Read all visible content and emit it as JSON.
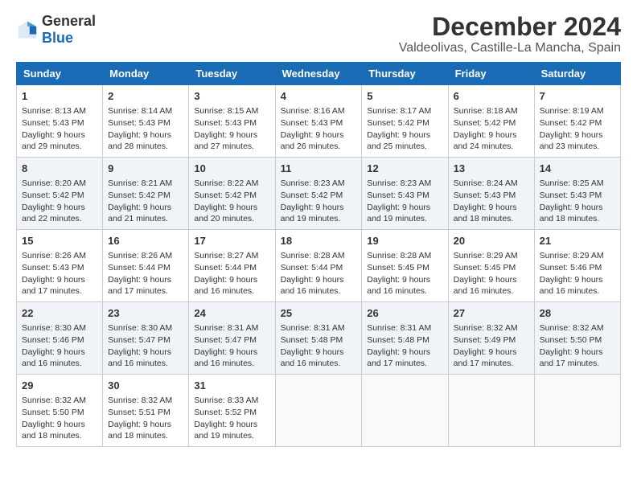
{
  "header": {
    "logo_general": "General",
    "logo_blue": "Blue",
    "title": "December 2024",
    "subtitle": "Valdeolivas, Castille-La Mancha, Spain"
  },
  "calendar": {
    "columns": [
      "Sunday",
      "Monday",
      "Tuesday",
      "Wednesday",
      "Thursday",
      "Friday",
      "Saturday"
    ],
    "weeks": [
      [
        {
          "day": "1",
          "sunrise": "Sunrise: 8:13 AM",
          "sunset": "Sunset: 5:43 PM",
          "daylight": "Daylight: 9 hours and 29 minutes."
        },
        {
          "day": "2",
          "sunrise": "Sunrise: 8:14 AM",
          "sunset": "Sunset: 5:43 PM",
          "daylight": "Daylight: 9 hours and 28 minutes."
        },
        {
          "day": "3",
          "sunrise": "Sunrise: 8:15 AM",
          "sunset": "Sunset: 5:43 PM",
          "daylight": "Daylight: 9 hours and 27 minutes."
        },
        {
          "day": "4",
          "sunrise": "Sunrise: 8:16 AM",
          "sunset": "Sunset: 5:43 PM",
          "daylight": "Daylight: 9 hours and 26 minutes."
        },
        {
          "day": "5",
          "sunrise": "Sunrise: 8:17 AM",
          "sunset": "Sunset: 5:42 PM",
          "daylight": "Daylight: 9 hours and 25 minutes."
        },
        {
          "day": "6",
          "sunrise": "Sunrise: 8:18 AM",
          "sunset": "Sunset: 5:42 PM",
          "daylight": "Daylight: 9 hours and 24 minutes."
        },
        {
          "day": "7",
          "sunrise": "Sunrise: 8:19 AM",
          "sunset": "Sunset: 5:42 PM",
          "daylight": "Daylight: 9 hours and 23 minutes."
        }
      ],
      [
        {
          "day": "8",
          "sunrise": "Sunrise: 8:20 AM",
          "sunset": "Sunset: 5:42 PM",
          "daylight": "Daylight: 9 hours and 22 minutes."
        },
        {
          "day": "9",
          "sunrise": "Sunrise: 8:21 AM",
          "sunset": "Sunset: 5:42 PM",
          "daylight": "Daylight: 9 hours and 21 minutes."
        },
        {
          "day": "10",
          "sunrise": "Sunrise: 8:22 AM",
          "sunset": "Sunset: 5:42 PM",
          "daylight": "Daylight: 9 hours and 20 minutes."
        },
        {
          "day": "11",
          "sunrise": "Sunrise: 8:23 AM",
          "sunset": "Sunset: 5:42 PM",
          "daylight": "Daylight: 9 hours and 19 minutes."
        },
        {
          "day": "12",
          "sunrise": "Sunrise: 8:23 AM",
          "sunset": "Sunset: 5:43 PM",
          "daylight": "Daylight: 9 hours and 19 minutes."
        },
        {
          "day": "13",
          "sunrise": "Sunrise: 8:24 AM",
          "sunset": "Sunset: 5:43 PM",
          "daylight": "Daylight: 9 hours and 18 minutes."
        },
        {
          "day": "14",
          "sunrise": "Sunrise: 8:25 AM",
          "sunset": "Sunset: 5:43 PM",
          "daylight": "Daylight: 9 hours and 18 minutes."
        }
      ],
      [
        {
          "day": "15",
          "sunrise": "Sunrise: 8:26 AM",
          "sunset": "Sunset: 5:43 PM",
          "daylight": "Daylight: 9 hours and 17 minutes."
        },
        {
          "day": "16",
          "sunrise": "Sunrise: 8:26 AM",
          "sunset": "Sunset: 5:44 PM",
          "daylight": "Daylight: 9 hours and 17 minutes."
        },
        {
          "day": "17",
          "sunrise": "Sunrise: 8:27 AM",
          "sunset": "Sunset: 5:44 PM",
          "daylight": "Daylight: 9 hours and 16 minutes."
        },
        {
          "day": "18",
          "sunrise": "Sunrise: 8:28 AM",
          "sunset": "Sunset: 5:44 PM",
          "daylight": "Daylight: 9 hours and 16 minutes."
        },
        {
          "day": "19",
          "sunrise": "Sunrise: 8:28 AM",
          "sunset": "Sunset: 5:45 PM",
          "daylight": "Daylight: 9 hours and 16 minutes."
        },
        {
          "day": "20",
          "sunrise": "Sunrise: 8:29 AM",
          "sunset": "Sunset: 5:45 PM",
          "daylight": "Daylight: 9 hours and 16 minutes."
        },
        {
          "day": "21",
          "sunrise": "Sunrise: 8:29 AM",
          "sunset": "Sunset: 5:46 PM",
          "daylight": "Daylight: 9 hours and 16 minutes."
        }
      ],
      [
        {
          "day": "22",
          "sunrise": "Sunrise: 8:30 AM",
          "sunset": "Sunset: 5:46 PM",
          "daylight": "Daylight: 9 hours and 16 minutes."
        },
        {
          "day": "23",
          "sunrise": "Sunrise: 8:30 AM",
          "sunset": "Sunset: 5:47 PM",
          "daylight": "Daylight: 9 hours and 16 minutes."
        },
        {
          "day": "24",
          "sunrise": "Sunrise: 8:31 AM",
          "sunset": "Sunset: 5:47 PM",
          "daylight": "Daylight: 9 hours and 16 minutes."
        },
        {
          "day": "25",
          "sunrise": "Sunrise: 8:31 AM",
          "sunset": "Sunset: 5:48 PM",
          "daylight": "Daylight: 9 hours and 16 minutes."
        },
        {
          "day": "26",
          "sunrise": "Sunrise: 8:31 AM",
          "sunset": "Sunset: 5:48 PM",
          "daylight": "Daylight: 9 hours and 17 minutes."
        },
        {
          "day": "27",
          "sunrise": "Sunrise: 8:32 AM",
          "sunset": "Sunset: 5:49 PM",
          "daylight": "Daylight: 9 hours and 17 minutes."
        },
        {
          "day": "28",
          "sunrise": "Sunrise: 8:32 AM",
          "sunset": "Sunset: 5:50 PM",
          "daylight": "Daylight: 9 hours and 17 minutes."
        }
      ],
      [
        {
          "day": "29",
          "sunrise": "Sunrise: 8:32 AM",
          "sunset": "Sunset: 5:50 PM",
          "daylight": "Daylight: 9 hours and 18 minutes."
        },
        {
          "day": "30",
          "sunrise": "Sunrise: 8:32 AM",
          "sunset": "Sunset: 5:51 PM",
          "daylight": "Daylight: 9 hours and 18 minutes."
        },
        {
          "day": "31",
          "sunrise": "Sunrise: 8:33 AM",
          "sunset": "Sunset: 5:52 PM",
          "daylight": "Daylight: 9 hours and 19 minutes."
        },
        null,
        null,
        null,
        null
      ]
    ]
  }
}
